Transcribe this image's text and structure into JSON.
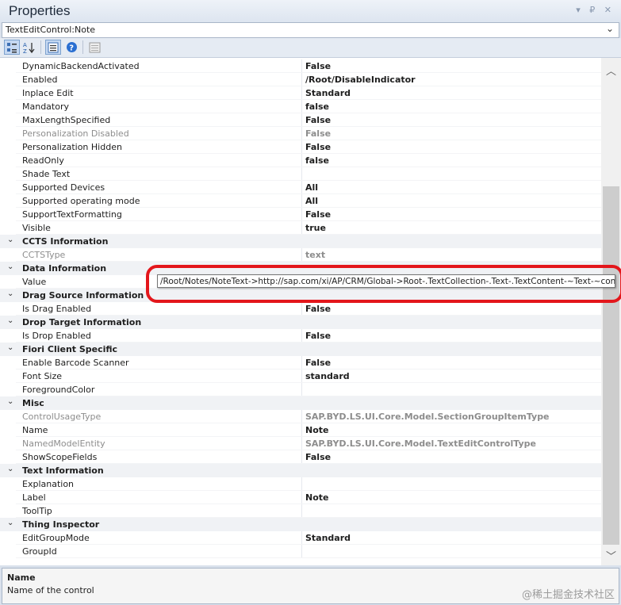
{
  "window": {
    "title": "Properties",
    "controls": "▾ ₽ ✕"
  },
  "object_selector": {
    "value": "TextEditControl:Note"
  },
  "toolbar": {
    "buttons": [
      {
        "icon": "categorized-icon",
        "active": true
      },
      {
        "icon": "alphabetical-icon",
        "active": false
      },
      {
        "icon": "properties-icon",
        "active": true
      },
      {
        "icon": "help-icon",
        "active": false
      },
      {
        "icon": "property-pages-icon",
        "active": false
      }
    ]
  },
  "grid": {
    "rows": [
      {
        "type": "prop",
        "name": "DynamicBackendActivated",
        "value": "False"
      },
      {
        "type": "prop",
        "name": "Enabled",
        "value": "/Root/DisableIndicator"
      },
      {
        "type": "prop",
        "name": "Inplace Edit",
        "value": "Standard"
      },
      {
        "type": "prop",
        "name": "Mandatory",
        "value": "false"
      },
      {
        "type": "prop",
        "name": "MaxLengthSpecified",
        "value": "False"
      },
      {
        "type": "prop",
        "name": "Personalization Disabled",
        "value": "False",
        "disabled": true
      },
      {
        "type": "prop",
        "name": "Personalization Hidden",
        "value": "False"
      },
      {
        "type": "prop",
        "name": "ReadOnly",
        "value": "false"
      },
      {
        "type": "prop",
        "name": "Shade Text",
        "value": ""
      },
      {
        "type": "prop",
        "name": "Supported Devices",
        "value": "All"
      },
      {
        "type": "prop",
        "name": "Supported operating mode",
        "value": "All"
      },
      {
        "type": "prop",
        "name": "SupportTextFormatting",
        "value": "False"
      },
      {
        "type": "prop",
        "name": "Visible",
        "value": "true"
      },
      {
        "type": "cat",
        "name": "CCTS Information"
      },
      {
        "type": "prop",
        "name": "CCTSType",
        "value": "text",
        "disabled": true
      },
      {
        "type": "cat",
        "name": "Data Information"
      },
      {
        "type": "prop",
        "name": "Value",
        "value": ""
      },
      {
        "type": "cat",
        "name": "Drag Source Information"
      },
      {
        "type": "prop",
        "name": "Is Drag Enabled",
        "value": "False"
      },
      {
        "type": "cat",
        "name": "Drop Target Information"
      },
      {
        "type": "prop",
        "name": "Is Drop Enabled",
        "value": "False"
      },
      {
        "type": "cat",
        "name": "Fiori Client Specific"
      },
      {
        "type": "prop",
        "name": "Enable Barcode Scanner",
        "value": "False"
      },
      {
        "type": "prop",
        "name": "Font Size",
        "value": "standard"
      },
      {
        "type": "prop",
        "name": "ForegroundColor",
        "value": ""
      },
      {
        "type": "cat",
        "name": "Misc"
      },
      {
        "type": "prop",
        "name": "ControlUsageType",
        "value": "SAP.BYD.LS.UI.Core.Model.SectionGroupItemType",
        "disabled": true
      },
      {
        "type": "prop",
        "name": "Name",
        "value": "Note"
      },
      {
        "type": "prop",
        "name": "NamedModelEntity",
        "value": "SAP.BYD.LS.UI.Core.Model.TextEditControlType",
        "disabled": true
      },
      {
        "type": "prop",
        "name": "ShowScopeFields",
        "value": "False"
      },
      {
        "type": "cat",
        "name": "Text Information"
      },
      {
        "type": "prop",
        "name": "Explanation",
        "value": ""
      },
      {
        "type": "prop",
        "name": "Label",
        "value": "Note"
      },
      {
        "type": "prop",
        "name": "ToolTip",
        "value": ""
      },
      {
        "type": "cat",
        "name": "Thing Inspector"
      },
      {
        "type": "prop",
        "name": "EditGroupMode",
        "value": "Standard"
      },
      {
        "type": "prop",
        "name": "GroupId",
        "value": ""
      }
    ]
  },
  "tooltip": {
    "text": "/Root/Notes/NoteText->http://sap.com/xi/AP/CRM/Global->Root-.TextCollection-.Text-.TextContent-~Text-~content"
  },
  "description": {
    "name": "Name",
    "text": "Name of the control"
  },
  "watermark": {
    "text": "@稀土掘金技术社区"
  }
}
